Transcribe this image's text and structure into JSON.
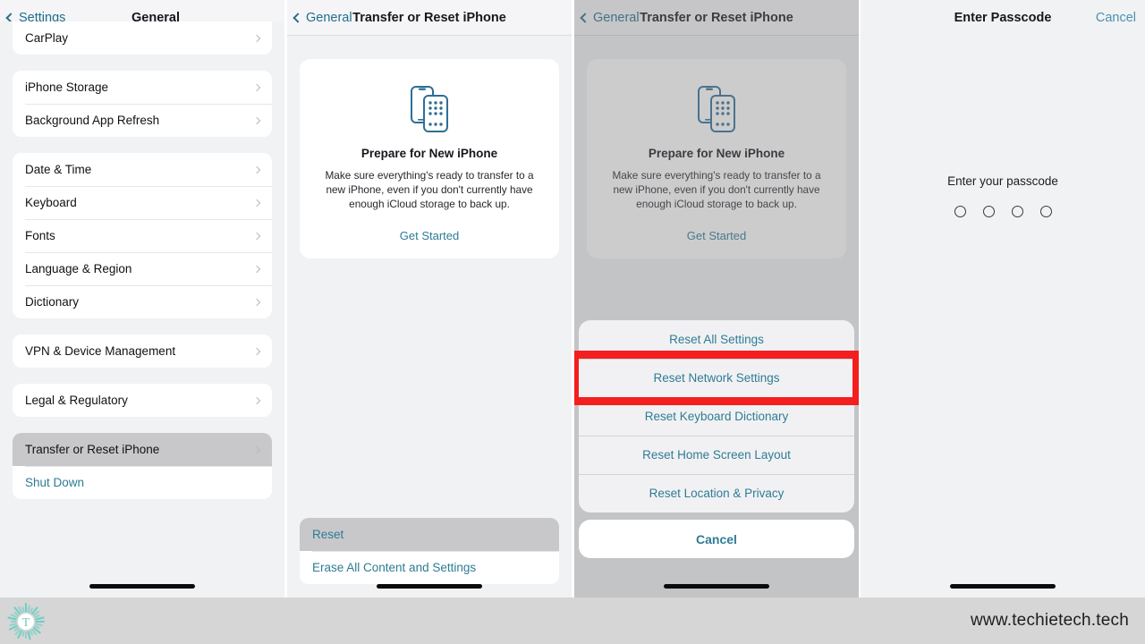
{
  "panel1": {
    "nav": {
      "back_label": "Settings",
      "title": "General"
    },
    "groups": [
      {
        "rows": [
          {
            "label": "CarPlay",
            "chevron": true
          }
        ]
      },
      {
        "rows": [
          {
            "label": "iPhone Storage",
            "chevron": true
          },
          {
            "label": "Background App Refresh",
            "chevron": true
          }
        ]
      },
      {
        "rows": [
          {
            "label": "Date & Time",
            "chevron": true
          },
          {
            "label": "Keyboard",
            "chevron": true
          },
          {
            "label": "Fonts",
            "chevron": true
          },
          {
            "label": "Language & Region",
            "chevron": true
          },
          {
            "label": "Dictionary",
            "chevron": true
          }
        ]
      },
      {
        "rows": [
          {
            "label": "VPN & Device Management",
            "chevron": true
          }
        ]
      },
      {
        "rows": [
          {
            "label": "Legal & Regulatory",
            "chevron": true
          }
        ]
      },
      {
        "rows": [
          {
            "label": "Transfer or Reset iPhone",
            "chevron": true,
            "selected": true
          },
          {
            "label": "Shut Down",
            "link": true
          }
        ]
      }
    ]
  },
  "panel2": {
    "nav": {
      "back_label": "General",
      "title": "Transfer or Reset iPhone"
    },
    "card": {
      "icon": "two-phones-icon",
      "title": "Prepare for New iPhone",
      "description": "Make sure everything's ready to transfer to a new iPhone, even if you don't currently have enough iCloud storage to back up.",
      "action": "Get Started"
    },
    "bottom_rows": [
      {
        "label": "Reset",
        "link": true,
        "selected": true
      },
      {
        "label": "Erase All Content and Settings",
        "link": true
      }
    ]
  },
  "panel3": {
    "nav": {
      "back_label": "General",
      "title": "Transfer or Reset iPhone"
    },
    "card": {
      "icon": "two-phones-icon",
      "title": "Prepare for New iPhone",
      "description": "Make sure everything's ready to transfer to a new iPhone, even if you don't currently have enough iCloud storage to back up.",
      "action": "Get Started"
    },
    "action_sheet": {
      "items": [
        "Reset All Settings",
        "Reset Network Settings",
        "Reset Keyboard Dictionary",
        "Reset Home Screen Layout",
        "Reset Location & Privacy"
      ],
      "cancel_label": "Cancel",
      "highlighted_index": 1,
      "highlight_color": "#f41e1e"
    }
  },
  "panel4": {
    "nav": {
      "title": "Enter Passcode",
      "cancel_label": "Cancel"
    },
    "prompt": "Enter your passcode",
    "dot_count": 4,
    "dots_filled": 0
  },
  "footer": {
    "logo": "techietech-burst-logo",
    "logo_letter": "T",
    "url": "www.techietech.tech",
    "logo_color": "#6fcfc4"
  }
}
